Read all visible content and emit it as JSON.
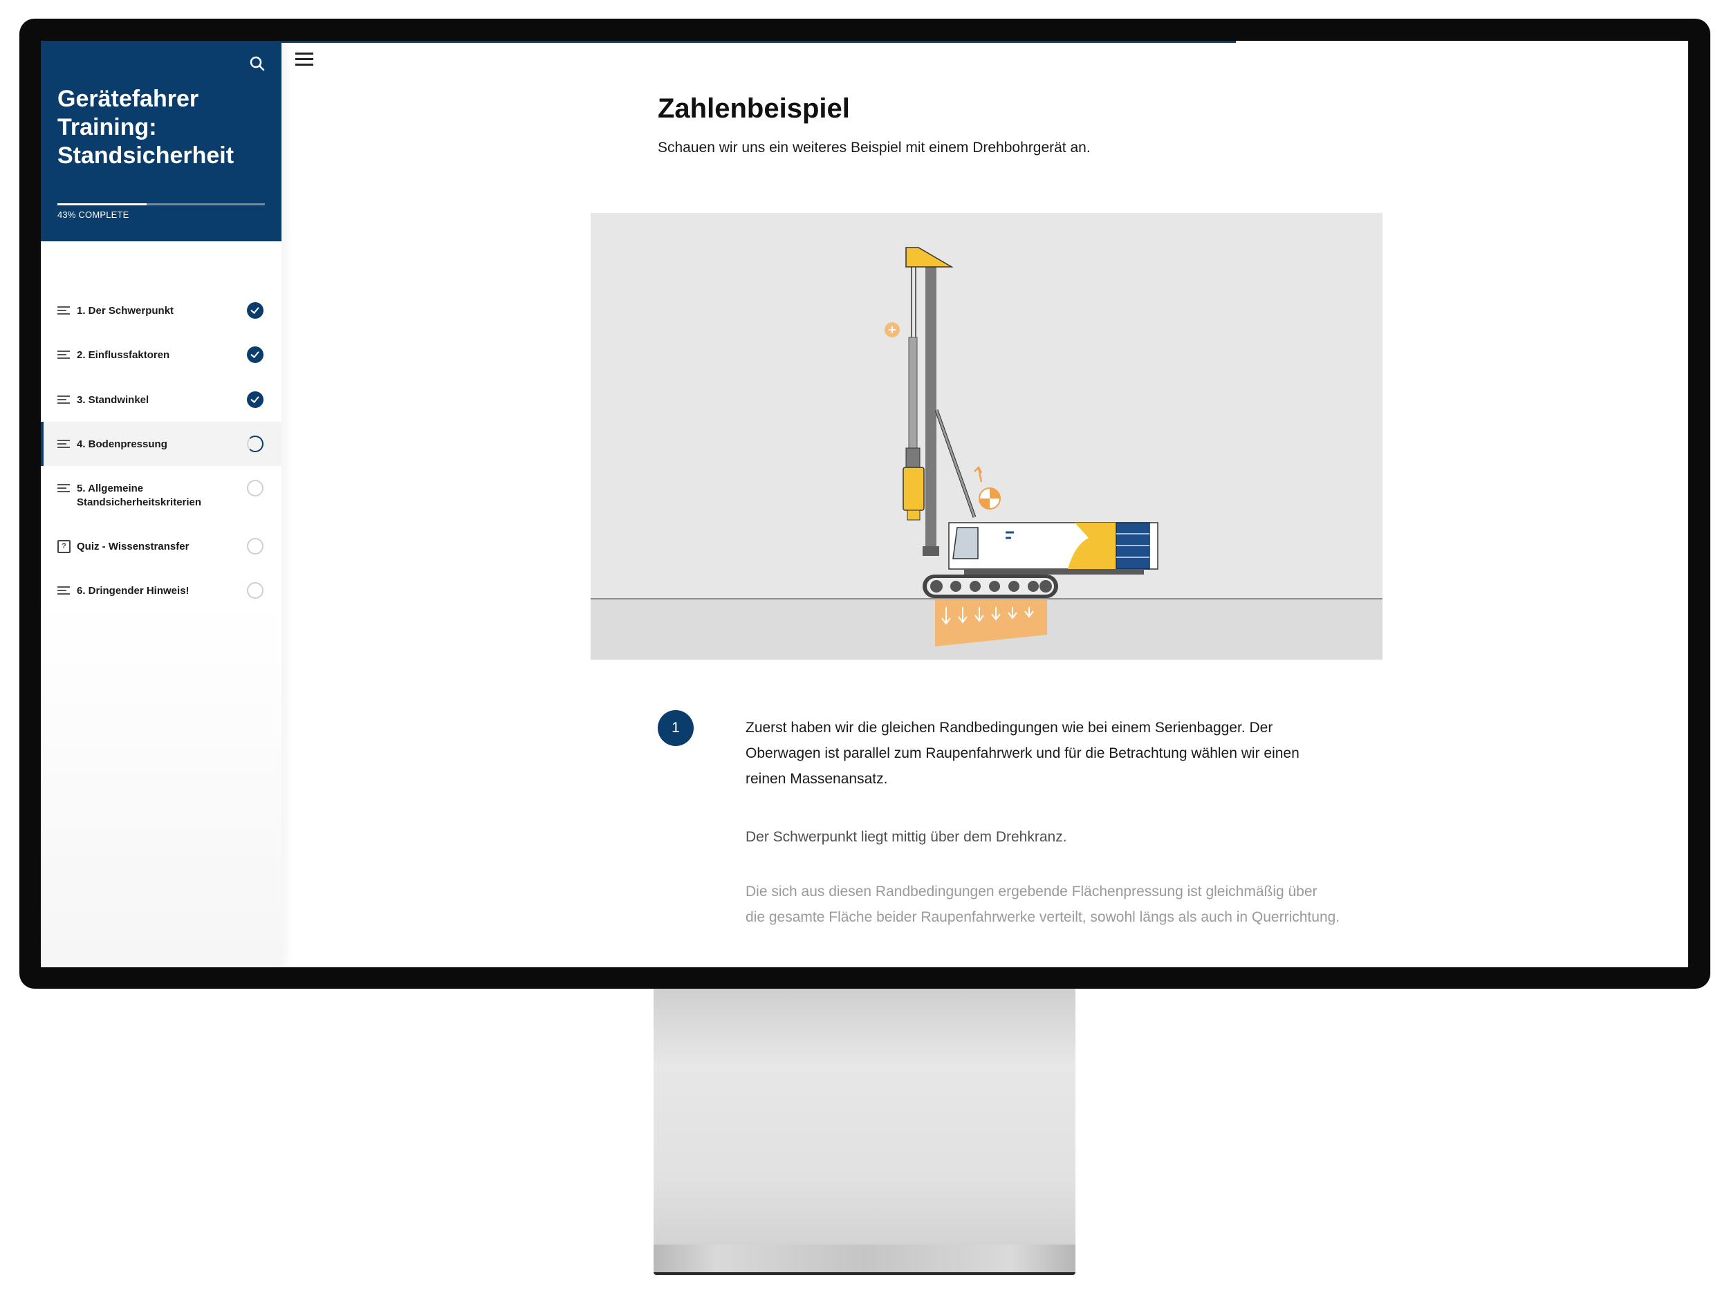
{
  "sidebar": {
    "title": "Gerätefahrer Training: Standsicherheit",
    "progress_label": "43% COMPLETE",
    "progress_percent": 43,
    "items": [
      {
        "label": "1. Der Schwerpunkt",
        "icon": "lines-icon",
        "status": "complete"
      },
      {
        "label": "2. Einflussfaktoren",
        "icon": "lines-icon",
        "status": "complete"
      },
      {
        "label": "3. Standwinkel",
        "icon": "lines-icon",
        "status": "complete"
      },
      {
        "label": "4. Bodenpressung",
        "icon": "lines-icon",
        "status": "in-progress"
      },
      {
        "label": "5. Allgemeine Standsicherheitskriterien",
        "icon": "lines-icon",
        "status": "not-started"
      },
      {
        "label": "Quiz - Wissenstransfer",
        "icon": "quiz-icon",
        "status": "not-started"
      },
      {
        "label": "6. Dringender Hinweis!",
        "icon": "lines-icon",
        "status": "not-started"
      }
    ]
  },
  "main": {
    "title": "Zahlenbeispiel",
    "intro": "Schauen wir uns ein weiteres Beispiel mit einem  Drehbohrgerät an.",
    "step_number": "1",
    "paragraphs": [
      "Zuerst haben wir die gleichen Randbedingungen wie bei einem Serienbagger. Der Oberwagen ist parallel zum Raupenfahrwerk und für die Betrachtung wählen wir einen reinen Massenansatz.",
      "Der Schwerpunkt liegt mittig über dem Drehkranz.",
      "Die sich aus diesen Randbedingungen ergebende Flächenpressung ist gleichmäßig über die gesamte Fläche beider Raupenfahrwerke verteilt, sowohl längs als auch in Querrichtung."
    ]
  },
  "colors": {
    "brand": "#0a3d6b",
    "accent_yellow": "#f4c233",
    "pressure_orange": "#f6b366"
  }
}
